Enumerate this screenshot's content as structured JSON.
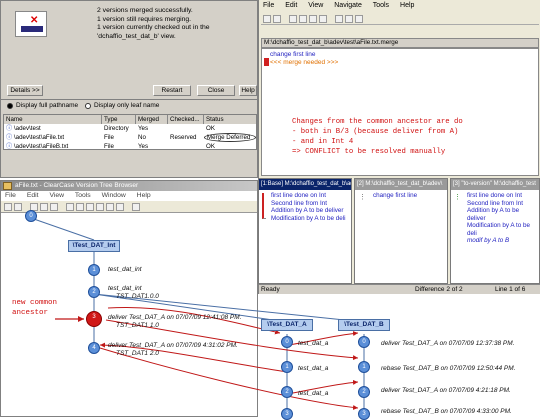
{
  "dialog": {
    "messages": [
      "2 versions merged successfully.",
      "1 version still requires merging.",
      "1 version currently checked out in the",
      "'dchaffio_test_dat_b' view."
    ],
    "buttons": {
      "details": "Details >>",
      "restart": "Restart",
      "close": "Close",
      "help": "Help"
    },
    "radio_full": "Display full pathname",
    "radio_leaf": "Display only leaf name",
    "columns": [
      "Name",
      "Type",
      "Merged",
      "Checked...",
      "Status"
    ],
    "rows": [
      {
        "name": "\\adev\\test",
        "type": "Directory",
        "merged": "Yes",
        "checked": "",
        "status": "OK"
      },
      {
        "name": "\\adev\\test\\aFile.txt",
        "type": "File",
        "merged": "No",
        "checked": "Reserved",
        "status": "Merge Deferred"
      },
      {
        "name": "\\adev\\test\\aFileB.txt",
        "type": "File",
        "merged": "Yes",
        "checked": "",
        "status": "OK"
      }
    ]
  },
  "merge": {
    "menu": [
      "File",
      "Edit",
      "View",
      "Navigate",
      "Tools",
      "Help"
    ],
    "path": "M:\\dchaffio_test_dat_b\\adev\\test\\aFile.txt.merge",
    "lines": [
      "change first line",
      "<<< merge needed >>>"
    ],
    "note": [
      "Changes from the common ancestor are do",
      "- both in B/3 (because deliver from A)",
      "- and in Int 4",
      "=> CONFLICT to be resolved manually"
    ],
    "pane1": {
      "header": "[1:Base] M:\\dchaffio_test_dat_b\\adev\\",
      "lines": [
        "first line done on Int",
        "Second line from Int",
        "Addition by A to be deliver",
        "Modification by A to be deli"
      ]
    },
    "pane2": {
      "header": "[2] M:\\dchaffio_test_dat_b\\adev\\",
      "lines": [
        "change first line"
      ]
    },
    "pane3": {
      "header": "[3] \"to-version\" M:\\dchaffio_test",
      "lines": [
        "first line done on Int",
        "Second line from Int",
        "Addition by A to be deliver",
        "Modification by A to be deli",
        "modif by A to B"
      ]
    },
    "status": {
      "ready": "Ready",
      "diff": "Difference 2 of 2",
      "line": "Line 1 of 6"
    }
  },
  "vtree": {
    "title": "aFile.txt - ClearCase Version Tree Browser",
    "menu": [
      "File",
      "Edit",
      "View",
      "Tools",
      "Window",
      "Help"
    ],
    "branches": {
      "int": "\\Test_DAT_Int",
      "a": "\\Test_DAT_A",
      "b": "\\Test_DAT_B"
    },
    "nodes": {
      "top": "0",
      "i1": "1",
      "i2": "2",
      "i3": "3",
      "i4": "4",
      "a0": "0",
      "a1": "1",
      "a2": "2",
      "a3": "3",
      "b0": "0",
      "b1": "1",
      "b2": "2",
      "b3": "3"
    },
    "labels": {
      "i1": "test_dat_int",
      "i2a": "test_dat_int",
      "i2b": "TST_DAT1.0.0",
      "i3a": "deliver Test_DAT_A on 07/07/09 12:41:08 PM.",
      "i3b": "TST_DAT1 1.0",
      "i4a": "deliver Test_DAT_A on 07/07/09 4:31:02 PM.",
      "i4b": "TST_DAT1 2.0",
      "a1": "test_dat_a",
      "a2": "test_dat_a",
      "a3": "test_dat_a",
      "b1": "deliver Test_DAT_A on 07/07/09 12:37:38 PM.",
      "b2": "rebase Test_DAT_B on 07/07/09 12:50:44 PM.",
      "b3": "deliver Test_DAT_A on 07/07/09 4:21:18 PM.",
      "b4": "rebase Test_DAT_B on 07/07/09 4:33:00 PM."
    },
    "annotation": [
      "new common",
      "ancestor"
    ]
  }
}
